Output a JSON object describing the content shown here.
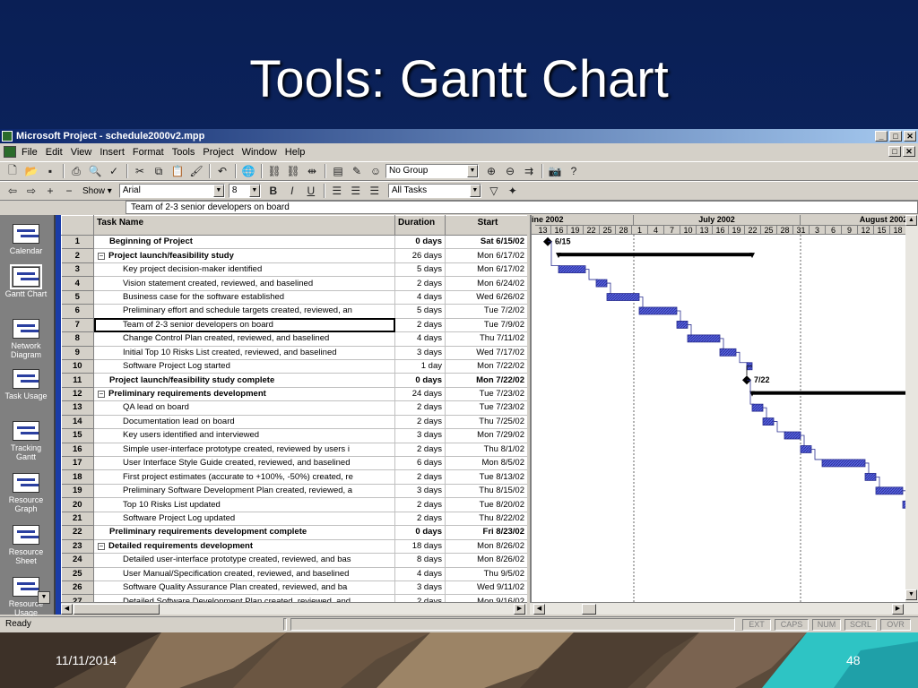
{
  "slide": {
    "title": "Tools: Gantt Chart",
    "date": "11/11/2014",
    "page_number": "48"
  },
  "window": {
    "title": "Microsoft Project - schedule2000v2.mpp",
    "buttons": [
      "_",
      "□",
      "✕"
    ]
  },
  "menu": [
    "File",
    "Edit",
    "View",
    "Insert",
    "Format",
    "Tools",
    "Project",
    "Window",
    "Help"
  ],
  "toolbar": {
    "group_value": "No Group",
    "show_label": "Show ▾",
    "font_value": "Arial",
    "size_value": "8",
    "filter_value": "All Tasks",
    "bold": "B",
    "italic": "I",
    "underline": "U"
  },
  "entry_bar": {
    "value": "Team of 2-3 senior developers on board"
  },
  "view_bar": [
    {
      "label": "Calendar"
    },
    {
      "label": "Gantt Chart"
    },
    {
      "label": "Network Diagram"
    },
    {
      "label": "Task Usage"
    },
    {
      "label": "Tracking Gantt"
    },
    {
      "label": "Resource Graph"
    },
    {
      "label": "Resource Sheet"
    },
    {
      "label": "Resource Usage"
    }
  ],
  "grid": {
    "headers": {
      "id": "",
      "name": "Task Name",
      "duration": "Duration",
      "start": "Start"
    },
    "rows": [
      {
        "id": "1",
        "name": "Beginning of Project",
        "duration": "0 days",
        "start": "Sat 6/15/02",
        "kind": "milestone"
      },
      {
        "id": "2",
        "name": "Project launch/feasibility study",
        "duration": "26 days",
        "start": "Mon 6/17/02",
        "kind": "summary"
      },
      {
        "id": "3",
        "name": "Key project decision-maker identified",
        "duration": "5 days",
        "start": "Mon 6/17/02",
        "kind": "task"
      },
      {
        "id": "4",
        "name": "Vision statement created, reviewed, and baselined",
        "duration": "2 days",
        "start": "Mon 6/24/02",
        "kind": "task"
      },
      {
        "id": "5",
        "name": "Business case for the software established",
        "duration": "4 days",
        "start": "Wed 6/26/02",
        "kind": "task"
      },
      {
        "id": "6",
        "name": "Preliminary effort and schedule targets created, reviewed, an",
        "duration": "5 days",
        "start": "Tue 7/2/02",
        "kind": "task"
      },
      {
        "id": "7",
        "name": "Team of 2-3 senior developers on board",
        "duration": "2 days",
        "start": "Tue 7/9/02",
        "kind": "task",
        "selected": true
      },
      {
        "id": "8",
        "name": "Change Control Plan created, reviewed, and baselined",
        "duration": "4 days",
        "start": "Thu 7/11/02",
        "kind": "task"
      },
      {
        "id": "9",
        "name": "Initial Top 10 Risks List created, reviewed, and baselined",
        "duration": "3 days",
        "start": "Wed 7/17/02",
        "kind": "task"
      },
      {
        "id": "10",
        "name": "Software Project Log started",
        "duration": "1 day",
        "start": "Mon 7/22/02",
        "kind": "task"
      },
      {
        "id": "11",
        "name": "Project launch/feasibility study complete",
        "duration": "0 days",
        "start": "Mon 7/22/02",
        "kind": "milestone"
      },
      {
        "id": "12",
        "name": "Preliminary requirements development",
        "duration": "24 days",
        "start": "Tue 7/23/02",
        "kind": "summary"
      },
      {
        "id": "13",
        "name": "QA lead on board",
        "duration": "2 days",
        "start": "Tue 7/23/02",
        "kind": "task"
      },
      {
        "id": "14",
        "name": "Documentation lead on board",
        "duration": "2 days",
        "start": "Thu 7/25/02",
        "kind": "task"
      },
      {
        "id": "15",
        "name": "Key users identified and interviewed",
        "duration": "3 days",
        "start": "Mon 7/29/02",
        "kind": "task"
      },
      {
        "id": "16",
        "name": "Simple user-interface prototype created, reviewed by users i",
        "duration": "2 days",
        "start": "Thu 8/1/02",
        "kind": "task"
      },
      {
        "id": "17",
        "name": "User Interface Style Guide created, reviewed, and baselined",
        "duration": "6 days",
        "start": "Mon 8/5/02",
        "kind": "task"
      },
      {
        "id": "18",
        "name": "First project estimates (accurate to +100%, -50%) created, re",
        "duration": "2 days",
        "start": "Tue 8/13/02",
        "kind": "task"
      },
      {
        "id": "19",
        "name": "Preliminary Software Development Plan created, reviewed, a",
        "duration": "3 days",
        "start": "Thu 8/15/02",
        "kind": "task"
      },
      {
        "id": "20",
        "name": "Top 10 Risks List updated",
        "duration": "2 days",
        "start": "Tue 8/20/02",
        "kind": "task"
      },
      {
        "id": "21",
        "name": "Software Project Log updated",
        "duration": "2 days",
        "start": "Thu 8/22/02",
        "kind": "task"
      },
      {
        "id": "22",
        "name": "Preliminary requirements development complete",
        "duration": "0 days",
        "start": "Fri 8/23/02",
        "kind": "milestone"
      },
      {
        "id": "23",
        "name": "Detailed requirements development",
        "duration": "18 days",
        "start": "Mon 8/26/02",
        "kind": "summary"
      },
      {
        "id": "24",
        "name": "Detailed user-interface prototype created, reviewed, and bas",
        "duration": "8 days",
        "start": "Mon 8/26/02",
        "kind": "task"
      },
      {
        "id": "25",
        "name": "User Manual/Specification created, reviewed, and baselined",
        "duration": "4 days",
        "start": "Thu 9/5/02",
        "kind": "task"
      },
      {
        "id": "26",
        "name": "Software Quality Assurance Plan created, reviewed, and ba",
        "duration": "3 days",
        "start": "Wed 9/11/02",
        "kind": "task"
      },
      {
        "id": "27",
        "name": "Detailed Software Development Plan created, reviewed, and",
        "duration": "2 days",
        "start": "Mon 9/16/02",
        "kind": "task"
      }
    ]
  },
  "timescale": {
    "months": [
      "ine 2002",
      "July 2002",
      "August 2002"
    ],
    "days": [
      "13",
      "16",
      "19",
      "22",
      "25",
      "28",
      "1",
      "4",
      "7",
      "10",
      "13",
      "16",
      "19",
      "22",
      "25",
      "28",
      "31",
      "3",
      "6",
      "9",
      "12",
      "15",
      "18"
    ]
  },
  "gantt_labels": {
    "m1": "6/15",
    "m11": "7/22"
  },
  "colors": {
    "task_bar": "#5560e0",
    "summary_bar": "#000000",
    "selection": "#000000",
    "slide_bg": "#0c2460"
  },
  "status": {
    "ready": "Ready",
    "indicators": [
      "EXT",
      "CAPS",
      "NUM",
      "SCRL",
      "OVR"
    ]
  }
}
